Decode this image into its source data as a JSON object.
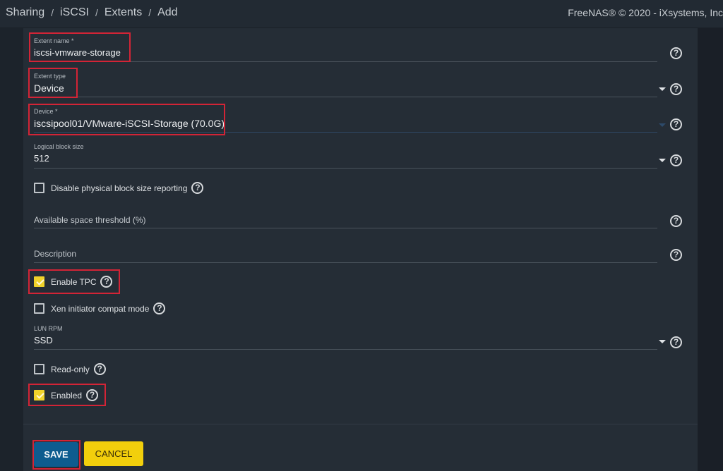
{
  "header": {
    "breadcrumb": [
      "Sharing",
      "iSCSI",
      "Extents",
      "Add"
    ],
    "copyright": "FreeNAS® © 2020 - iXsystems, Inc"
  },
  "form": {
    "extent_name": {
      "label": "Extent name *",
      "value": "iscsi-vmware-storage"
    },
    "extent_type": {
      "label": "Extent type",
      "value": "Device"
    },
    "device": {
      "label": "Device *",
      "value": "iscsipool01/VMware-iSCSI-Storage (70.0G)"
    },
    "logical_block_size": {
      "label": "Logical block size",
      "value": "512"
    },
    "disable_physical_block": {
      "label": "Disable physical block size reporting",
      "checked": false
    },
    "available_space_threshold": {
      "placeholder": "Available space threshold (%)",
      "value": ""
    },
    "description": {
      "placeholder": "Description",
      "value": ""
    },
    "enable_tpc": {
      "label": "Enable TPC",
      "checked": true
    },
    "xen_compat": {
      "label": "Xen initiator compat mode",
      "checked": false
    },
    "lun_rpm": {
      "label": "LUN RPM",
      "value": "SSD"
    },
    "read_only": {
      "label": "Read-only",
      "checked": false
    },
    "enabled": {
      "label": "Enabled",
      "checked": true
    }
  },
  "buttons": {
    "save": "SAVE",
    "cancel": "CANCEL"
  },
  "help_glyph": "?",
  "colors": {
    "accent_yellow": "#f2cf0c",
    "save_blue": "#0e5c8f",
    "highlight_red": "#d32436"
  }
}
